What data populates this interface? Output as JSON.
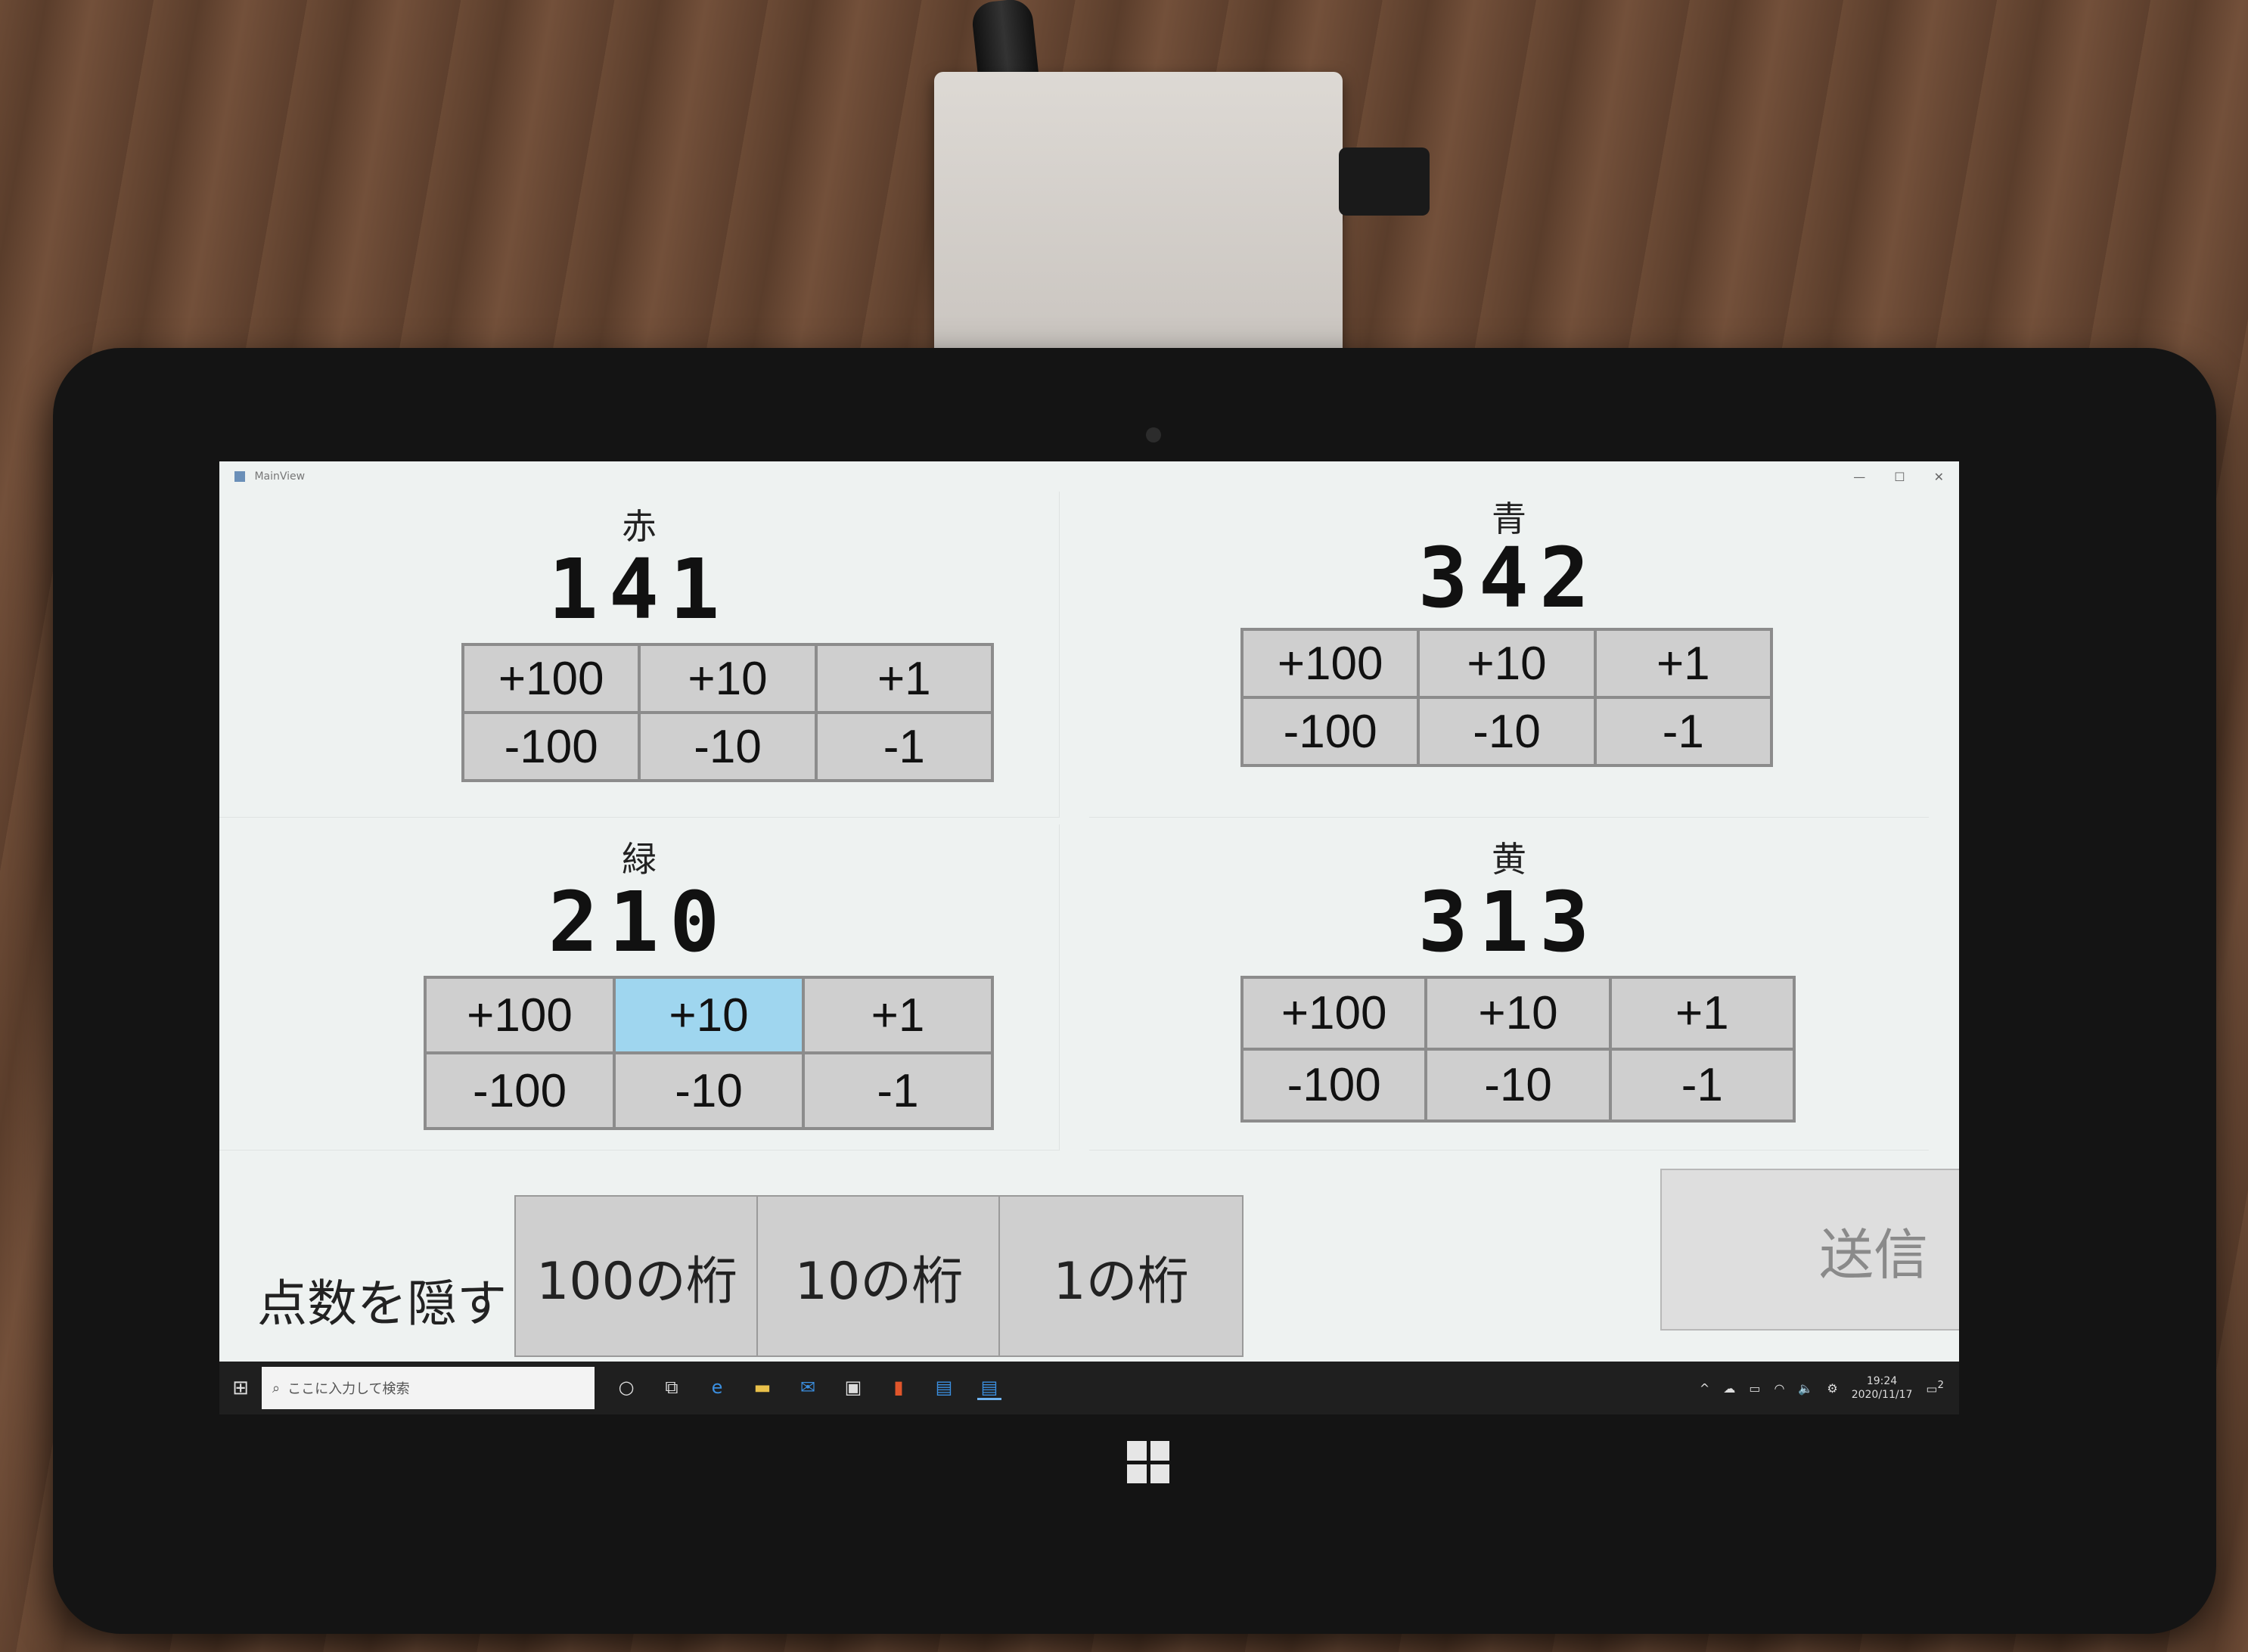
{
  "window": {
    "title": "MainView",
    "controls": [
      "—",
      "☐",
      "✕"
    ]
  },
  "teams": [
    {
      "name": "赤",
      "score": "141",
      "buttons": [
        "+100",
        "+10",
        "+1",
        "-100",
        "-10",
        "-1"
      ]
    },
    {
      "name": "青",
      "score": "342",
      "buttons": [
        "+100",
        "+10",
        "+1",
        "-100",
        "-10",
        "-1"
      ]
    },
    {
      "name": "緑",
      "score": "210",
      "buttons": [
        "+100",
        "+10",
        "+1",
        "-100",
        "-10",
        "-1"
      ]
    },
    {
      "name": "黄",
      "score": "313",
      "buttons": [
        "+100",
        "+10",
        "+1",
        "-100",
        "-10",
        "-1"
      ]
    }
  ],
  "hide_controls": {
    "label": "点数を隠す",
    "buttons": [
      "100の桁",
      "10の桁",
      "1の桁"
    ]
  },
  "send_button": "送信",
  "taskbar": {
    "search_placeholder": "ここに入力して検索",
    "time": "19:24",
    "date": "2020/11/17",
    "notification_count": "2"
  },
  "colors": {
    "screen_bg": "#eef2f1",
    "button_bg": "#cfcfcf",
    "hover_bg": "#9fd6ef",
    "taskbar_bg": "#1f1f1f"
  }
}
